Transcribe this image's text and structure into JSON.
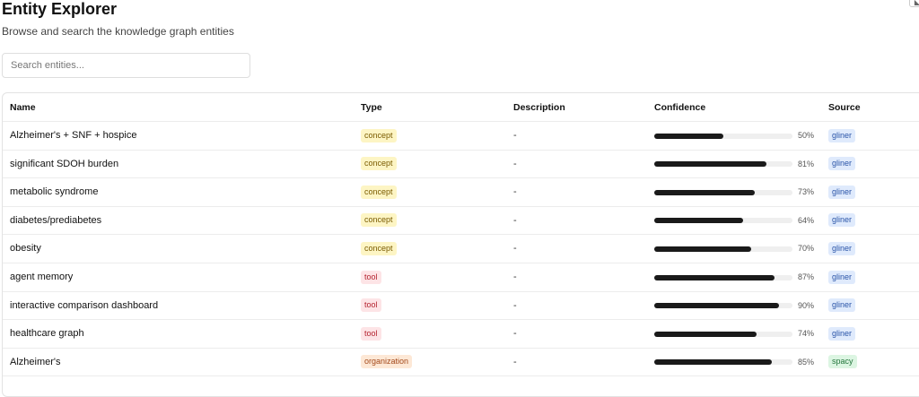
{
  "header": {
    "title": "Entity Explorer",
    "subtitle": "Browse and search the knowledge graph entities"
  },
  "search": {
    "placeholder": "Search entities...",
    "value": ""
  },
  "table": {
    "columns": [
      "Name",
      "Type",
      "Description",
      "Confidence",
      "Source"
    ],
    "rows": [
      {
        "name": "Alzheimer's + SNF + hospice",
        "type": "concept",
        "description": "-",
        "confidence": 0.5,
        "confidence_label": "50%",
        "source": "gliner"
      },
      {
        "name": "significant SDOH burden",
        "type": "concept",
        "description": "-",
        "confidence": 0.81,
        "confidence_label": "81%",
        "source": "gliner"
      },
      {
        "name": "metabolic syndrome",
        "type": "concept",
        "description": "-",
        "confidence": 0.73,
        "confidence_label": "73%",
        "source": "gliner"
      },
      {
        "name": "diabetes/prediabetes",
        "type": "concept",
        "description": "-",
        "confidence": 0.64,
        "confidence_label": "64%",
        "source": "gliner"
      },
      {
        "name": "obesity",
        "type": "concept",
        "description": "-",
        "confidence": 0.7,
        "confidence_label": "70%",
        "source": "gliner"
      },
      {
        "name": "agent memory",
        "type": "tool",
        "description": "-",
        "confidence": 0.87,
        "confidence_label": "87%",
        "source": "gliner"
      },
      {
        "name": "interactive comparison dashboard",
        "type": "tool",
        "description": "-",
        "confidence": 0.9,
        "confidence_label": "90%",
        "source": "gliner"
      },
      {
        "name": "healthcare graph",
        "type": "tool",
        "description": "-",
        "confidence": 0.74,
        "confidence_label": "74%",
        "source": "gliner"
      },
      {
        "name": "Alzheimer's",
        "type": "organization",
        "description": "-",
        "confidence": 0.85,
        "confidence_label": "85%",
        "source": "spacy"
      }
    ]
  },
  "icons": {
    "corner": "collapse-icon"
  }
}
